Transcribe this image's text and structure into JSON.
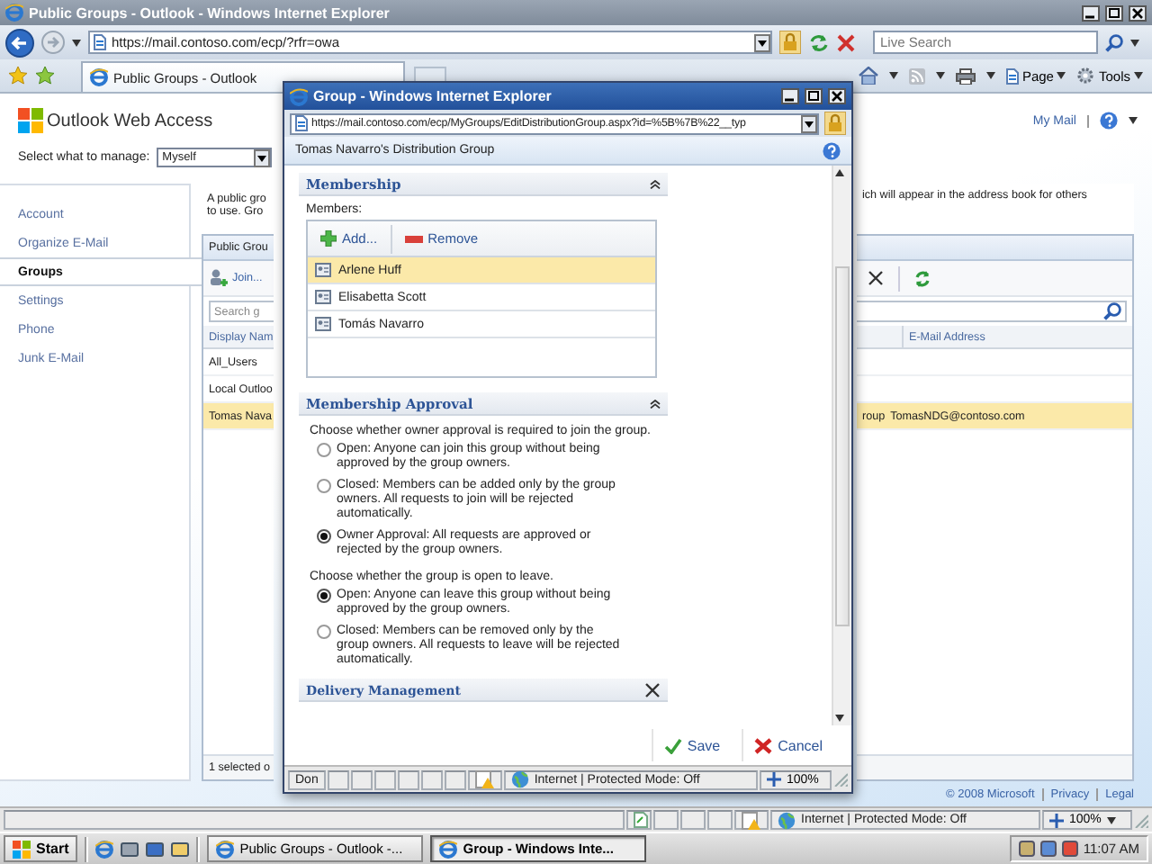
{
  "browser": {
    "title": "Public Groups - Outlook - Windows Internet Explorer",
    "url": "https://mail.contoso.com/ecp/?rfr=owa",
    "search": {
      "placeholder": "Live Search"
    },
    "tab": "Public Groups - Outlook",
    "commands": [
      "Page",
      "Tools"
    ]
  },
  "header": {
    "logo": "Outlook Web Access",
    "link": "My Mail",
    "manage_label": "Select what to manage:",
    "manage_value": "Myself"
  },
  "nav": [
    {
      "label": "Account",
      "selected": false
    },
    {
      "label": "Organize E-Mail",
      "selected": false
    },
    {
      "label": "Groups",
      "selected": true
    },
    {
      "label": "Settings",
      "selected": false
    },
    {
      "label": "Phone",
      "selected": false
    },
    {
      "label": "Junk E-Mail",
      "selected": false
    }
  ],
  "groups_panel": {
    "description_left": [
      "A public gro",
      "to use. Gro"
    ],
    "description_right": "ich will appear in the address book for others",
    "title": "Public Grou",
    "join": "Join...",
    "search_placeholder": "Search g",
    "columns": [
      "Display Nam",
      "E-Mail Address"
    ],
    "rows": [
      {
        "display_name": "All_Users",
        "selected": false
      },
      {
        "display_name": "Local Outloo",
        "selected": false
      },
      {
        "display_name": "Tomas Nava",
        "column_2": "roup",
        "email": "TomasNDG@contoso.com",
        "selected": true
      }
    ],
    "footer": "1 selected o"
  },
  "popup": {
    "title": "Group - Windows Internet Explorer",
    "url": "https://mail.contoso.com/ecp/MyGroups/EditDistributionGroup.aspx?id=%5B%7B%22__typ",
    "heading": "Tomas Navarro's Distribution Group",
    "membership": {
      "title": "Membership",
      "label": "Members:",
      "actions": [
        "Add...",
        "Remove"
      ],
      "items": [
        {
          "name": "Arlene Huff",
          "selected": true
        },
        {
          "name": "Elisabetta Scott",
          "selected": false
        },
        {
          "name": "Tomás Navarro",
          "selected": false
        }
      ]
    },
    "approval": {
      "title": "Membership Approval",
      "groups": [
        {
          "prompt": "Choose whether owner approval is required to join the group.",
          "options": [
            {
              "label": "Open: Anyone can join this group without being approved by the group owners.",
              "selected": false
            },
            {
              "label": "Closed: Members can be added only by the group owners. All requests to join will be rejected automatically.",
              "selected": false
            },
            {
              "label": "Owner Approval: All requests are approved or rejected by the group owners.",
              "selected": true
            }
          ]
        },
        {
          "prompt": "Choose whether the group is open to leave.",
          "options": [
            {
              "label": "Open: Anyone can leave this group without being approved by the group owners.",
              "selected": true
            },
            {
              "label": "Closed: Members can be removed only by the group owners. All requests to leave will be rejected automatically.",
              "selected": false
            }
          ]
        }
      ]
    },
    "next_section": "Delivery Management",
    "buttons": [
      "Save",
      "Cancel"
    ],
    "status": {
      "text": "Don",
      "zone": "Internet | Protected Mode: Off",
      "zoom": "100%"
    }
  },
  "footer": {
    "copyright": "© 2008 Microsoft",
    "links": [
      "Privacy",
      "Legal"
    ]
  },
  "status_bar": {
    "zone": "Internet | Protected Mode: Off",
    "zoom": "100%"
  },
  "taskbar": {
    "start": "Start",
    "tasks": [
      {
        "label": "Public Groups - Outlook -...",
        "selected": false
      },
      {
        "label": "Group - Windows Inte...",
        "selected": true
      }
    ],
    "clock": "11:07 AM"
  }
}
